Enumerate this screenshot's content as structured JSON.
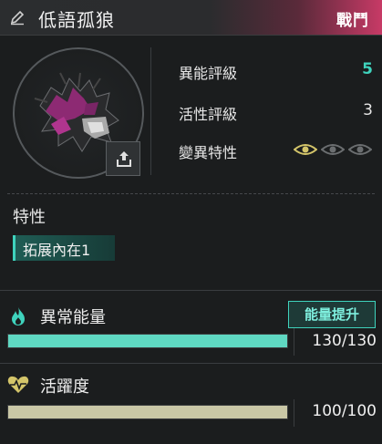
{
  "header": {
    "title": "低語孤狼",
    "tag": "戰鬥",
    "edit_icon": "pencil-icon"
  },
  "portrait": {
    "export_icon": "export-icon"
  },
  "stats": {
    "anomaly_rating": {
      "label": "異能評級",
      "value": "5"
    },
    "vitality_rating": {
      "label": "活性評級",
      "value": "3"
    },
    "mutation_trait": {
      "label": "變異特性",
      "eyes_total": 3,
      "eyes_active": 1
    }
  },
  "traits": {
    "title": "特性",
    "items": [
      "拓展內在1"
    ]
  },
  "energy": {
    "label": "異常能量",
    "button": "能量提升",
    "value_text": "130/130",
    "fill_fraction": 1.0,
    "color": "#5fd8c2",
    "icon": "flame-icon"
  },
  "vitality": {
    "label": "活躍度",
    "value_text": "100/100",
    "fill_fraction": 1.0,
    "color": "#c9c7a6",
    "icon": "heartbeat-icon"
  },
  "colors": {
    "accent": "#3fd3bd",
    "header_accent": "#c73a66",
    "eye_active": "#d4c56a",
    "eye_inactive": "#6b6e70"
  }
}
